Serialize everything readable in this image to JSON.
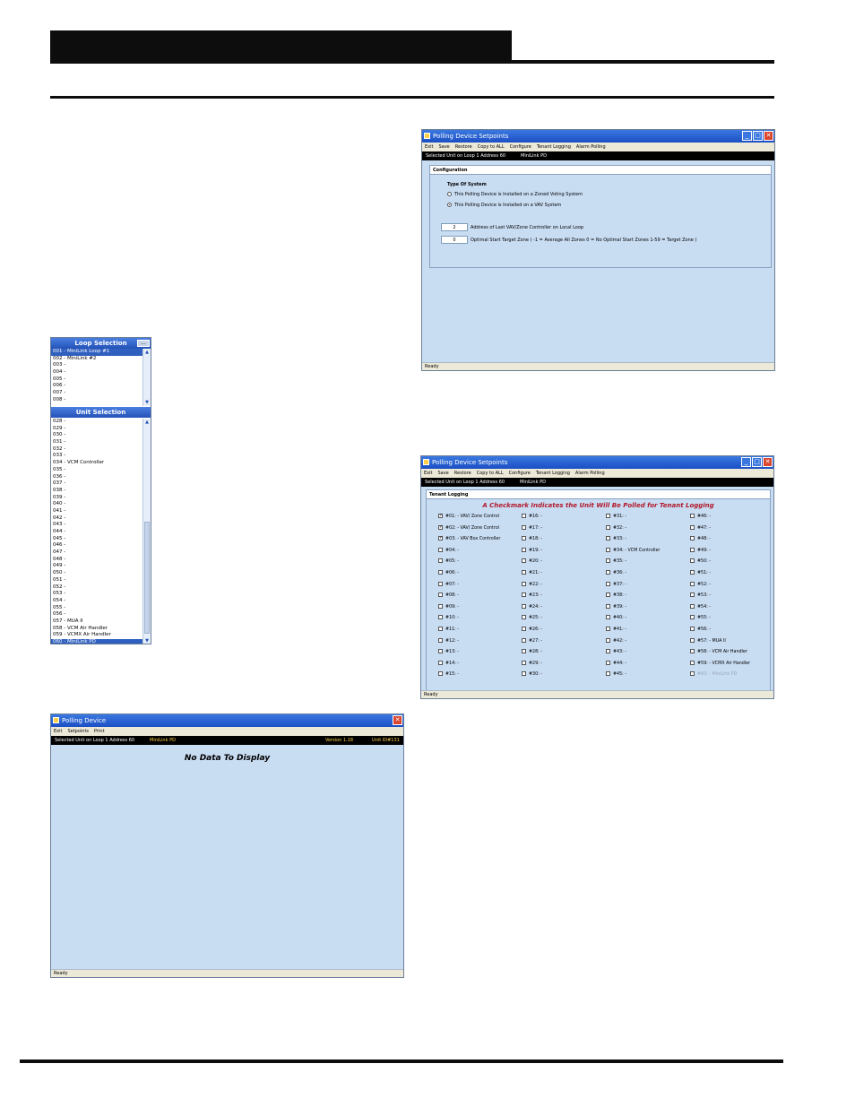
{
  "loop_selection": {
    "title": "Loop Selection",
    "more_button": "...",
    "items": [
      "001 - MiniLink Loop #1",
      "002 - MiniLink #2",
      "003 -",
      "004 -",
      "005 -",
      "006 -",
      "007 -",
      "008 -"
    ],
    "selected_index": 0
  },
  "unit_selection": {
    "title": "Unit Selection",
    "items": [
      "028 -",
      "029 -",
      "030 -",
      "031 -",
      "032 -",
      "033 -",
      "034 - VCM Controller",
      "035 -",
      "036 -",
      "037 -",
      "038 -",
      "039 -",
      "040 -",
      "041 -",
      "042 -",
      "043 -",
      "044 -",
      "045 -",
      "046 -",
      "047 -",
      "048 -",
      "049 -",
      "050 -",
      "051 -",
      "052 -",
      "053 -",
      "054 -",
      "055 -",
      "056 -",
      "057 - MUA II",
      "058 - VCM Air Handler",
      "059 - VCMX Air Handler",
      "060 - MiniLink PD"
    ],
    "selected_index": 32
  },
  "setpoints_config": {
    "title": "Polling Device Setpoints",
    "menu": [
      "Exit",
      "Save",
      "Restore",
      "Copy to ALL",
      "Configure",
      "Tenant Logging",
      "Alarm Polling"
    ],
    "info_left": "Selected Unit on Loop 1 Address 60",
    "info_mid": "MiniLink PD",
    "panel_title": "Configuration",
    "system_type_label": "Type Of System",
    "option_zoned": "This Polling Device is Installed on a Zoned Voting System",
    "option_vav": "This Polling Device is Installed on a VAV System",
    "selected_option": "vav",
    "last_vav_value": "2",
    "last_vav_label": "Address of Last VAV/Zone Controller on Local Loop",
    "optimal_value": "0",
    "optimal_label": "Optimal Start Target Zone  ( -1 = Average All Zones   0 = No Optimal Start Zones   1-59 = Target Zone )",
    "status": "Ready"
  },
  "setpoints_tenant": {
    "title": "Polling Device Setpoints",
    "menu": [
      "Exit",
      "Save",
      "Restore",
      "Copy to ALL",
      "Configure",
      "Tenant Logging",
      "Alarm Polling"
    ],
    "info_left": "Selected Unit on Loop 1 Address 60",
    "info_mid": "MiniLink PD",
    "panel_title": "Tenant Logging",
    "heading": "A Checkmark Indicates the Unit Will Be Polled for Tenant Logging",
    "columns": [
      [
        "#01: - VAV/ Zone Control",
        "#02: - VAV/ Zone Control",
        "#03: - VAV Box Controller",
        "#04: -",
        "#05: -",
        "#06: -",
        "#07: -",
        "#08: -",
        "#09: -",
        "#10: -",
        "#11: -",
        "#12: -",
        "#13: -",
        "#14: -",
        "#15: -"
      ],
      [
        "#16: -",
        "#17: -",
        "#18: -",
        "#19: -",
        "#20: -",
        "#21: -",
        "#22: -",
        "#23: -",
        "#24: -",
        "#25: -",
        "#26: -",
        "#27: -",
        "#28: -",
        "#29: -",
        "#30: -"
      ],
      [
        "#31: -",
        "#32: -",
        "#33: -",
        "#34: - VCM Controller",
        "#35: -",
        "#36: -",
        "#37: -",
        "#38: -",
        "#39: -",
        "#40: -",
        "#41: -",
        "#42: -",
        "#43: -",
        "#44: -",
        "#45: -"
      ],
      [
        "#46: -",
        "#47: -",
        "#48: -",
        "#49: -",
        "#50: -",
        "#51: -",
        "#52: -",
        "#53: -",
        "#54: -",
        "#55: -",
        "#56: -",
        "#57: - MUA II",
        "#58: - VCM Air Handler",
        "#59: - VCMX Air Handler",
        "#60: - MiniLink PD"
      ]
    ],
    "checked": [
      "#01: - VAV/ Zone Control",
      "#02: - VAV/ Zone Control",
      "#03: - VAV Box Controller"
    ],
    "status": "Ready"
  },
  "polling_device": {
    "title": "Polling Device",
    "menu": [
      "Exit",
      "Setpoints",
      "Print"
    ],
    "info_left": "Selected Unit on Loop 1 Address 60",
    "info_mid": "MiniLink PD",
    "version": "Version 1.18",
    "unit_id": "Unit ID#131",
    "no_data": "No Data To Display",
    "status": "Ready"
  }
}
